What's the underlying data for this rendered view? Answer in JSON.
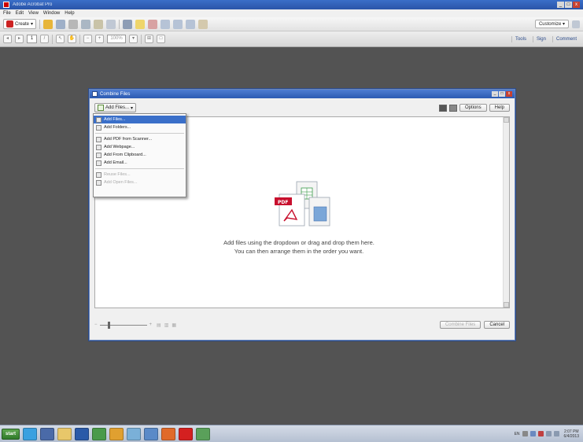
{
  "window": {
    "title": "Adobe Acrobat Pro",
    "controls": [
      "_",
      "□",
      "x"
    ]
  },
  "menu": [
    "File",
    "Edit",
    "View",
    "Window",
    "Help"
  ],
  "toolbar": {
    "create_label": "Create",
    "create_arrow": "▾",
    "customize_label": "Customize",
    "customize_arrow": "▾",
    "page_number": "1",
    "zoom_value": "100%",
    "tabs": [
      "Tools",
      "Sign",
      "Comment"
    ]
  },
  "dialog": {
    "title": "Combine Files",
    "controls": [
      "_",
      "□",
      "x"
    ],
    "add_files_label": "Add Files...",
    "add_files_arrow": "▾",
    "options_label": "Options",
    "help_label": "Help",
    "drop_text_line1": "Add files using the dropdown or drag and drop them here.",
    "drop_text_line2": "You can then arrange them in the order you want.",
    "combine_label": "Combine Files",
    "cancel_label": "Cancel"
  },
  "dropdown": {
    "items": [
      {
        "label": "Add Files...",
        "state": "highlighted"
      },
      {
        "label": "Add Folders...",
        "state": "normal"
      },
      {
        "label": "separator"
      },
      {
        "label": "Add PDF from Scanner...",
        "state": "normal"
      },
      {
        "label": "Add Webpage...",
        "state": "normal"
      },
      {
        "label": "Add From Clipboard...",
        "state": "normal"
      },
      {
        "label": "Add Email...",
        "state": "normal"
      },
      {
        "label": "separator"
      },
      {
        "label": "Reuse Files...",
        "state": "disabled"
      },
      {
        "label": "Add Open Files...",
        "state": "disabled"
      }
    ]
  },
  "taskbar": {
    "start_label": "start",
    "tray_lang": "EN",
    "clock_time": "2:07 PM",
    "clock_date": "6/4/2013"
  },
  "colors": {
    "workspace": "#535353",
    "title_bar": "#2c5bb2",
    "highlight": "#3a6fc9",
    "pdf_red": "#c8102e"
  }
}
